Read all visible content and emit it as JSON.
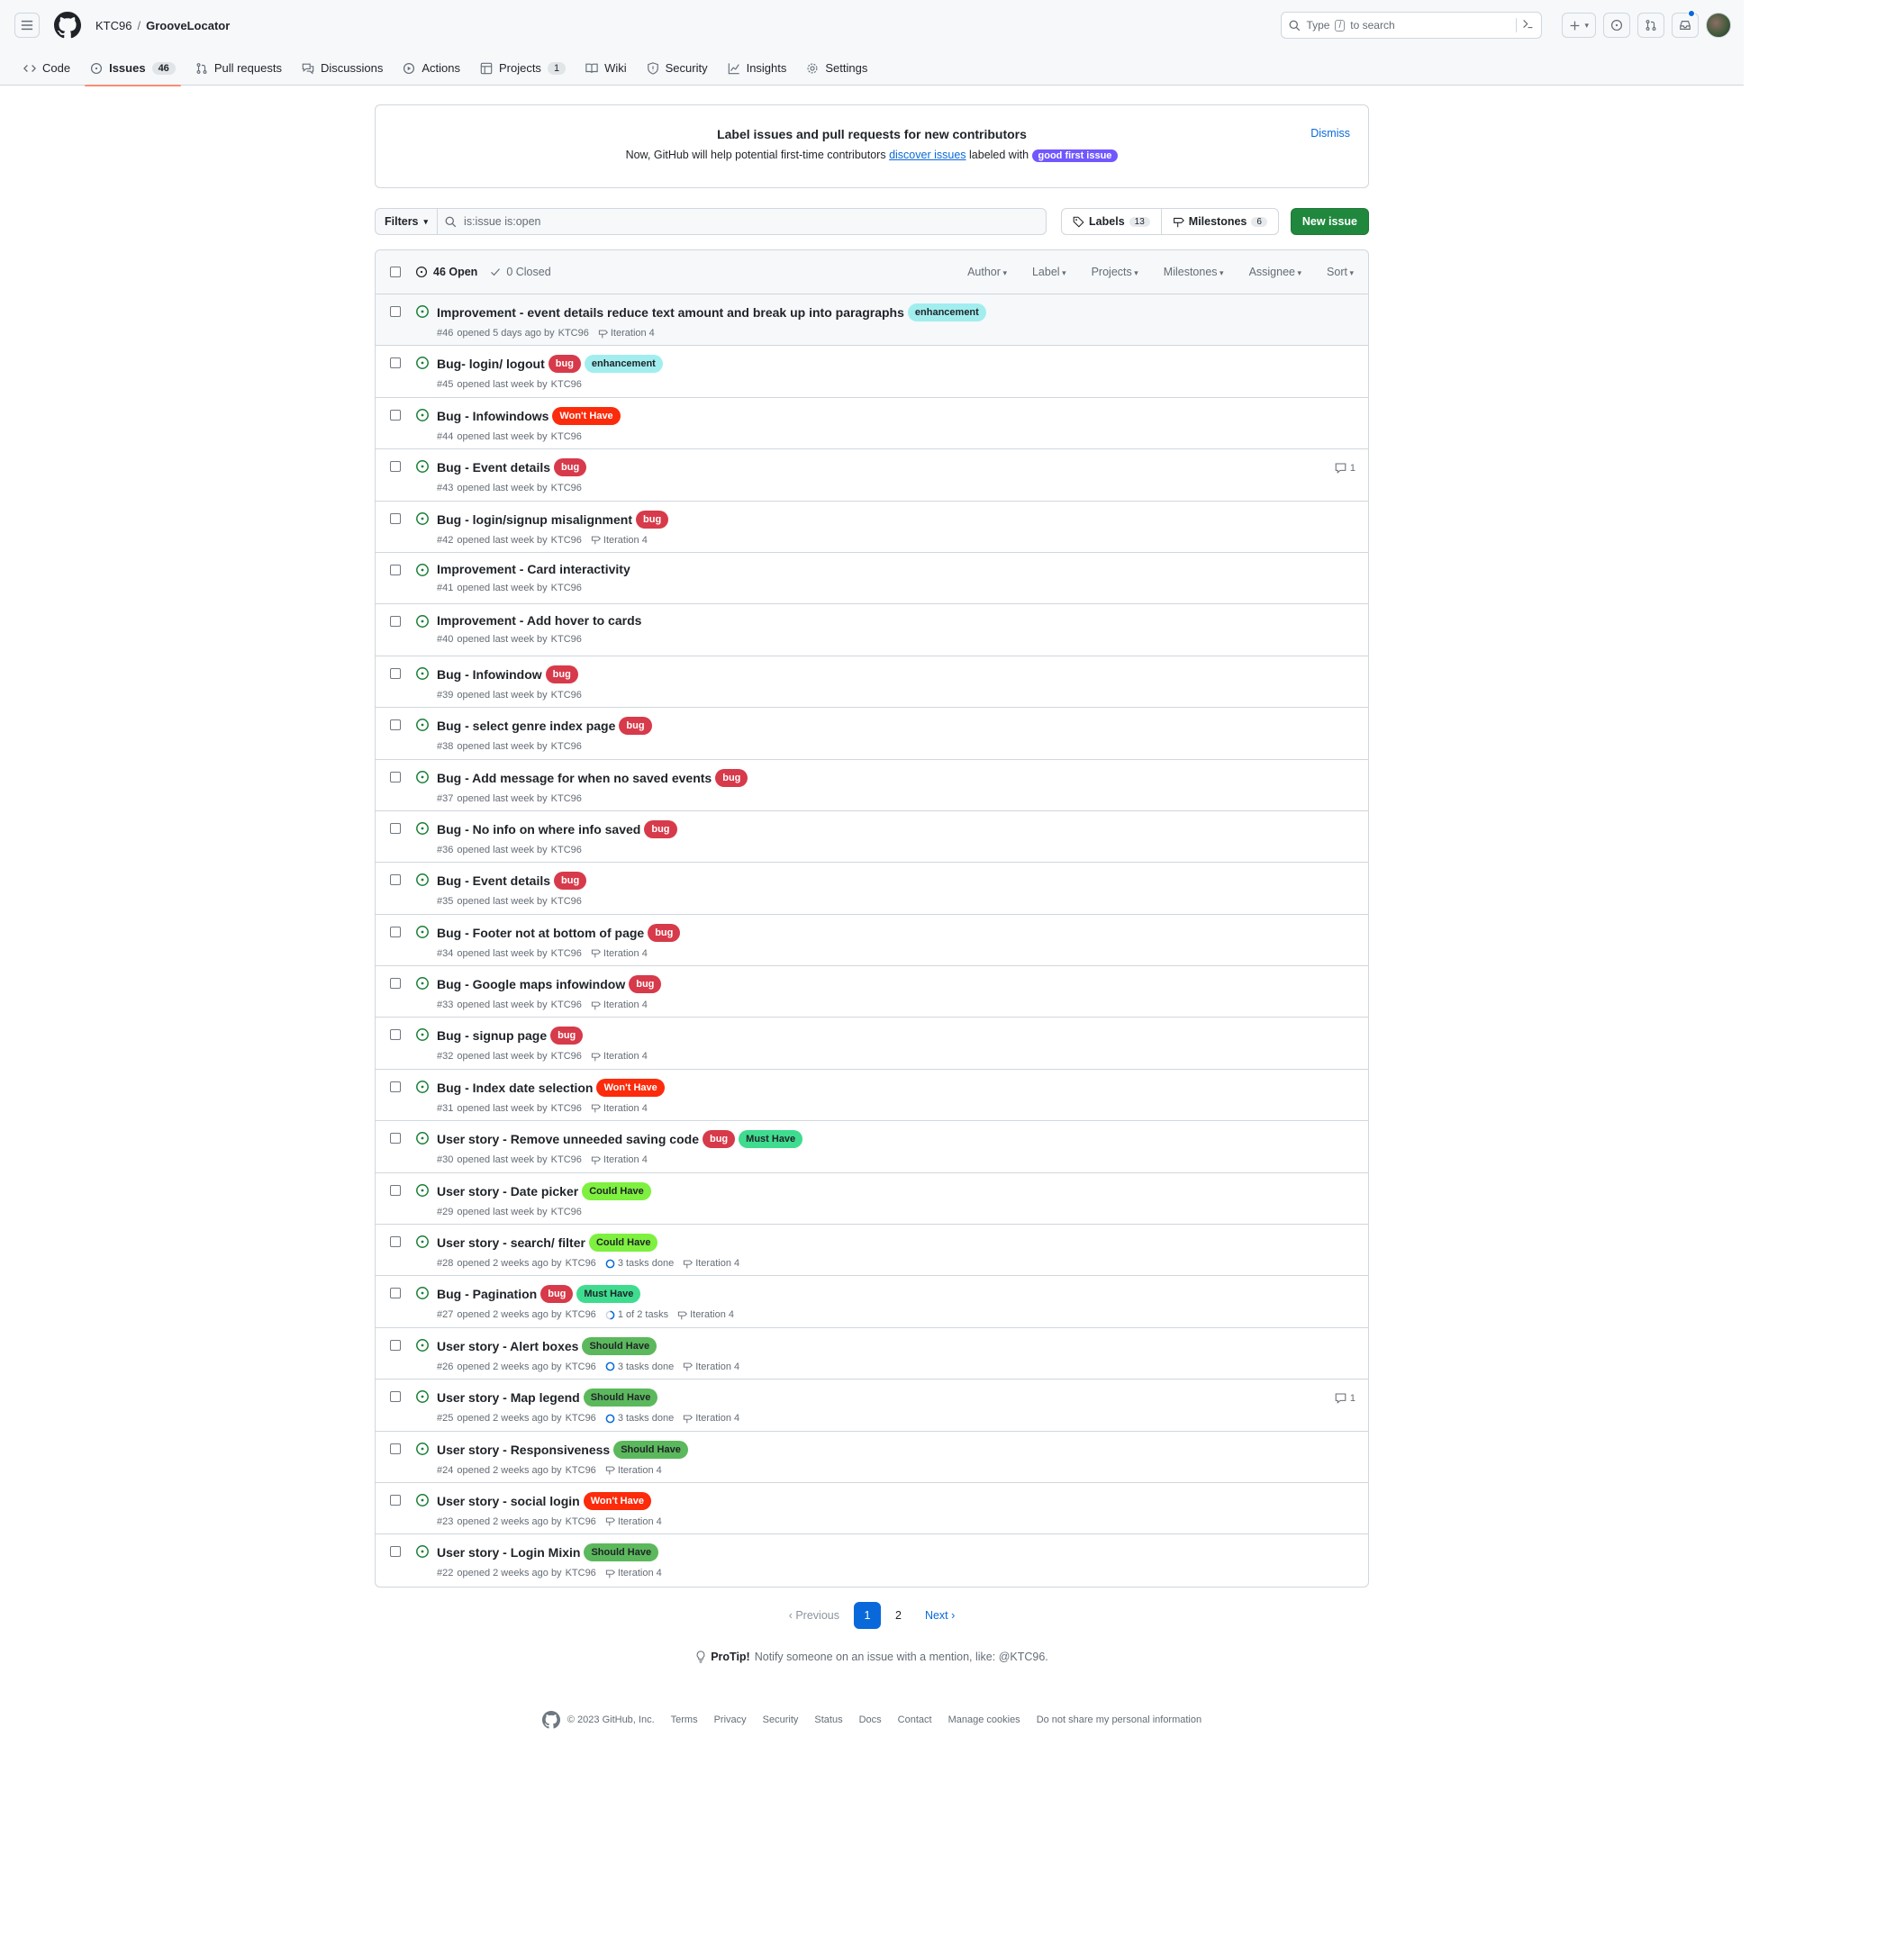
{
  "header": {
    "owner": "KTC96",
    "separator": "/",
    "repo": "GrooveLocator",
    "search_prefix": "Type",
    "search_key": "/",
    "search_suffix": "to search"
  },
  "tabs": [
    {
      "label": "Code"
    },
    {
      "label": "Issues",
      "count": "46"
    },
    {
      "label": "Pull requests"
    },
    {
      "label": "Discussions"
    },
    {
      "label": "Actions"
    },
    {
      "label": "Projects",
      "count": "1"
    },
    {
      "label": "Wiki"
    },
    {
      "label": "Security"
    },
    {
      "label": "Insights"
    },
    {
      "label": "Settings"
    }
  ],
  "banner": {
    "title": "Label issues and pull requests for new contributors",
    "text_before": "Now, GitHub will help potential first-time contributors",
    "link": "discover issues",
    "text_after": "labeled with",
    "label": "good first issue",
    "dismiss": "Dismiss"
  },
  "controls": {
    "filters": "Filters",
    "query": "is:issue is:open",
    "labels": "Labels",
    "labels_count": "13",
    "milestones": "Milestones",
    "milestones_count": "6",
    "new_issue": "New issue"
  },
  "list_header": {
    "open": "46 Open",
    "closed": "0 Closed",
    "filters": [
      "Author",
      "Label",
      "Projects",
      "Milestones",
      "Assignee",
      "Sort"
    ]
  },
  "label_colors": {
    "bug": {
      "bg": "#d73a4a",
      "fg": "#ffffff"
    },
    "enhancement": {
      "bg": "#a2eeef",
      "fg": "#1f2328"
    },
    "Won't Have": {
      "bg": "#fb2b0b",
      "fg": "#ffffff"
    },
    "Must Have": {
      "bg": "#3fdc8f",
      "fg": "#1f2328"
    },
    "Could Have": {
      "bg": "#7ef03f",
      "fg": "#1f2328"
    },
    "Should Have": {
      "bg": "#5cb85c",
      "fg": "#1f2328"
    }
  },
  "issues": [
    {
      "title": "Improvement - event details reduce text amount and break up into paragraphs",
      "labels": [
        "enhancement"
      ],
      "number": "#46",
      "opened": "opened 5 days ago by",
      "author": "KTC96",
      "milestone": "Iteration 4",
      "tasks": "",
      "comments": ""
    },
    {
      "title": "Bug- login/ logout",
      "labels": [
        "bug",
        "enhancement"
      ],
      "number": "#45",
      "opened": "opened last week by",
      "author": "KTC96",
      "milestone": "",
      "tasks": "",
      "comments": ""
    },
    {
      "title": "Bug - Infowindows",
      "labels": [
        "Won't Have"
      ],
      "number": "#44",
      "opened": "opened last week by",
      "author": "KTC96",
      "milestone": "",
      "tasks": "",
      "comments": ""
    },
    {
      "title": "Bug - Event details",
      "labels": [
        "bug"
      ],
      "number": "#43",
      "opened": "opened last week by",
      "author": "KTC96",
      "milestone": "",
      "tasks": "",
      "comments": "1"
    },
    {
      "title": "Bug - login/signup misalignment",
      "labels": [
        "bug"
      ],
      "number": "#42",
      "opened": "opened last week by",
      "author": "KTC96",
      "milestone": "Iteration 4",
      "tasks": "",
      "comments": ""
    },
    {
      "title": "Improvement - Card interactivity",
      "labels": [],
      "number": "#41",
      "opened": "opened last week by",
      "author": "KTC96",
      "milestone": "",
      "tasks": "",
      "comments": ""
    },
    {
      "title": "Improvement - Add hover to cards",
      "labels": [],
      "number": "#40",
      "opened": "opened last week by",
      "author": "KTC96",
      "milestone": "",
      "tasks": "",
      "comments": ""
    },
    {
      "title": "Bug - Infowindow",
      "labels": [
        "bug"
      ],
      "number": "#39",
      "opened": "opened last week by",
      "author": "KTC96",
      "milestone": "",
      "tasks": "",
      "comments": ""
    },
    {
      "title": "Bug - select genre index page",
      "labels": [
        "bug"
      ],
      "number": "#38",
      "opened": "opened last week by",
      "author": "KTC96",
      "milestone": "",
      "tasks": "",
      "comments": ""
    },
    {
      "title": "Bug - Add message for when no saved events",
      "labels": [
        "bug"
      ],
      "number": "#37",
      "opened": "opened last week by",
      "author": "KTC96",
      "milestone": "",
      "tasks": "",
      "comments": ""
    },
    {
      "title": "Bug - No info on where info saved",
      "labels": [
        "bug"
      ],
      "number": "#36",
      "opened": "opened last week by",
      "author": "KTC96",
      "milestone": "",
      "tasks": "",
      "comments": ""
    },
    {
      "title": "Bug - Event details",
      "labels": [
        "bug"
      ],
      "number": "#35",
      "opened": "opened last week by",
      "author": "KTC96",
      "milestone": "",
      "tasks": "",
      "comments": ""
    },
    {
      "title": "Bug - Footer not at bottom of page",
      "labels": [
        "bug"
      ],
      "number": "#34",
      "opened": "opened last week by",
      "author": "KTC96",
      "milestone": "Iteration 4",
      "tasks": "",
      "comments": ""
    },
    {
      "title": "Bug - Google maps infowindow",
      "labels": [
        "bug"
      ],
      "number": "#33",
      "opened": "opened last week by",
      "author": "KTC96",
      "milestone": "Iteration 4",
      "tasks": "",
      "comments": ""
    },
    {
      "title": "Bug - signup page",
      "labels": [
        "bug"
      ],
      "number": "#32",
      "opened": "opened last week by",
      "author": "KTC96",
      "milestone": "Iteration 4",
      "tasks": "",
      "comments": ""
    },
    {
      "title": "Bug - Index date selection",
      "labels": [
        "Won't Have"
      ],
      "number": "#31",
      "opened": "opened last week by",
      "author": "KTC96",
      "milestone": "Iteration 4",
      "tasks": "",
      "comments": ""
    },
    {
      "title": "User story - Remove unneeded saving code",
      "labels": [
        "bug",
        "Must Have"
      ],
      "number": "#30",
      "opened": "opened last week by",
      "author": "KTC96",
      "milestone": "Iteration 4",
      "tasks": "",
      "comments": ""
    },
    {
      "title": "User story - Date picker",
      "labels": [
        "Could Have"
      ],
      "number": "#29",
      "opened": "opened last week by",
      "author": "KTC96",
      "milestone": "",
      "tasks": "",
      "comments": ""
    },
    {
      "title": "User story - search/ filter",
      "labels": [
        "Could Have"
      ],
      "number": "#28",
      "opened": "opened 2 weeks ago by",
      "author": "KTC96",
      "milestone": "Iteration 4",
      "tasks": "3 tasks done",
      "comments": ""
    },
    {
      "title": "Bug - Pagination",
      "labels": [
        "bug",
        "Must Have"
      ],
      "number": "#27",
      "opened": "opened 2 weeks ago by",
      "author": "KTC96",
      "milestone": "Iteration 4",
      "tasks": "1 of 2 tasks",
      "comments": ""
    },
    {
      "title": "User story - Alert boxes",
      "labels": [
        "Should Have"
      ],
      "number": "#26",
      "opened": "opened 2 weeks ago by",
      "author": "KTC96",
      "milestone": "Iteration 4",
      "tasks": "3 tasks done",
      "comments": ""
    },
    {
      "title": "User story - Map legend",
      "labels": [
        "Should Have"
      ],
      "number": "#25",
      "opened": "opened 2 weeks ago by",
      "author": "KTC96",
      "milestone": "Iteration 4",
      "tasks": "3 tasks done",
      "comments": "1"
    },
    {
      "title": "User story - Responsiveness",
      "labels": [
        "Should Have"
      ],
      "number": "#24",
      "opened": "opened 2 weeks ago by",
      "author": "KTC96",
      "milestone": "Iteration 4",
      "tasks": "",
      "comments": ""
    },
    {
      "title": "User story - social login",
      "labels": [
        "Won't Have"
      ],
      "number": "#23",
      "opened": "opened 2 weeks ago by",
      "author": "KTC96",
      "milestone": "Iteration 4",
      "tasks": "",
      "comments": ""
    },
    {
      "title": "User story - Login Mixin",
      "labels": [
        "Should Have"
      ],
      "number": "#22",
      "opened": "opened 2 weeks ago by",
      "author": "KTC96",
      "milestone": "Iteration 4",
      "tasks": "",
      "comments": ""
    }
  ],
  "pagination": {
    "previous": "Previous",
    "pages": [
      "1",
      "2"
    ],
    "current": "1",
    "next": "Next"
  },
  "protip": {
    "bold": "ProTip!",
    "text": "Notify someone on an issue with a mention, like: @KTC96."
  },
  "footer": {
    "copyright": "© 2023 GitHub, Inc.",
    "links": [
      "Terms",
      "Privacy",
      "Security",
      "Status",
      "Docs",
      "Contact",
      "Manage cookies",
      "Do not share my personal information"
    ]
  }
}
